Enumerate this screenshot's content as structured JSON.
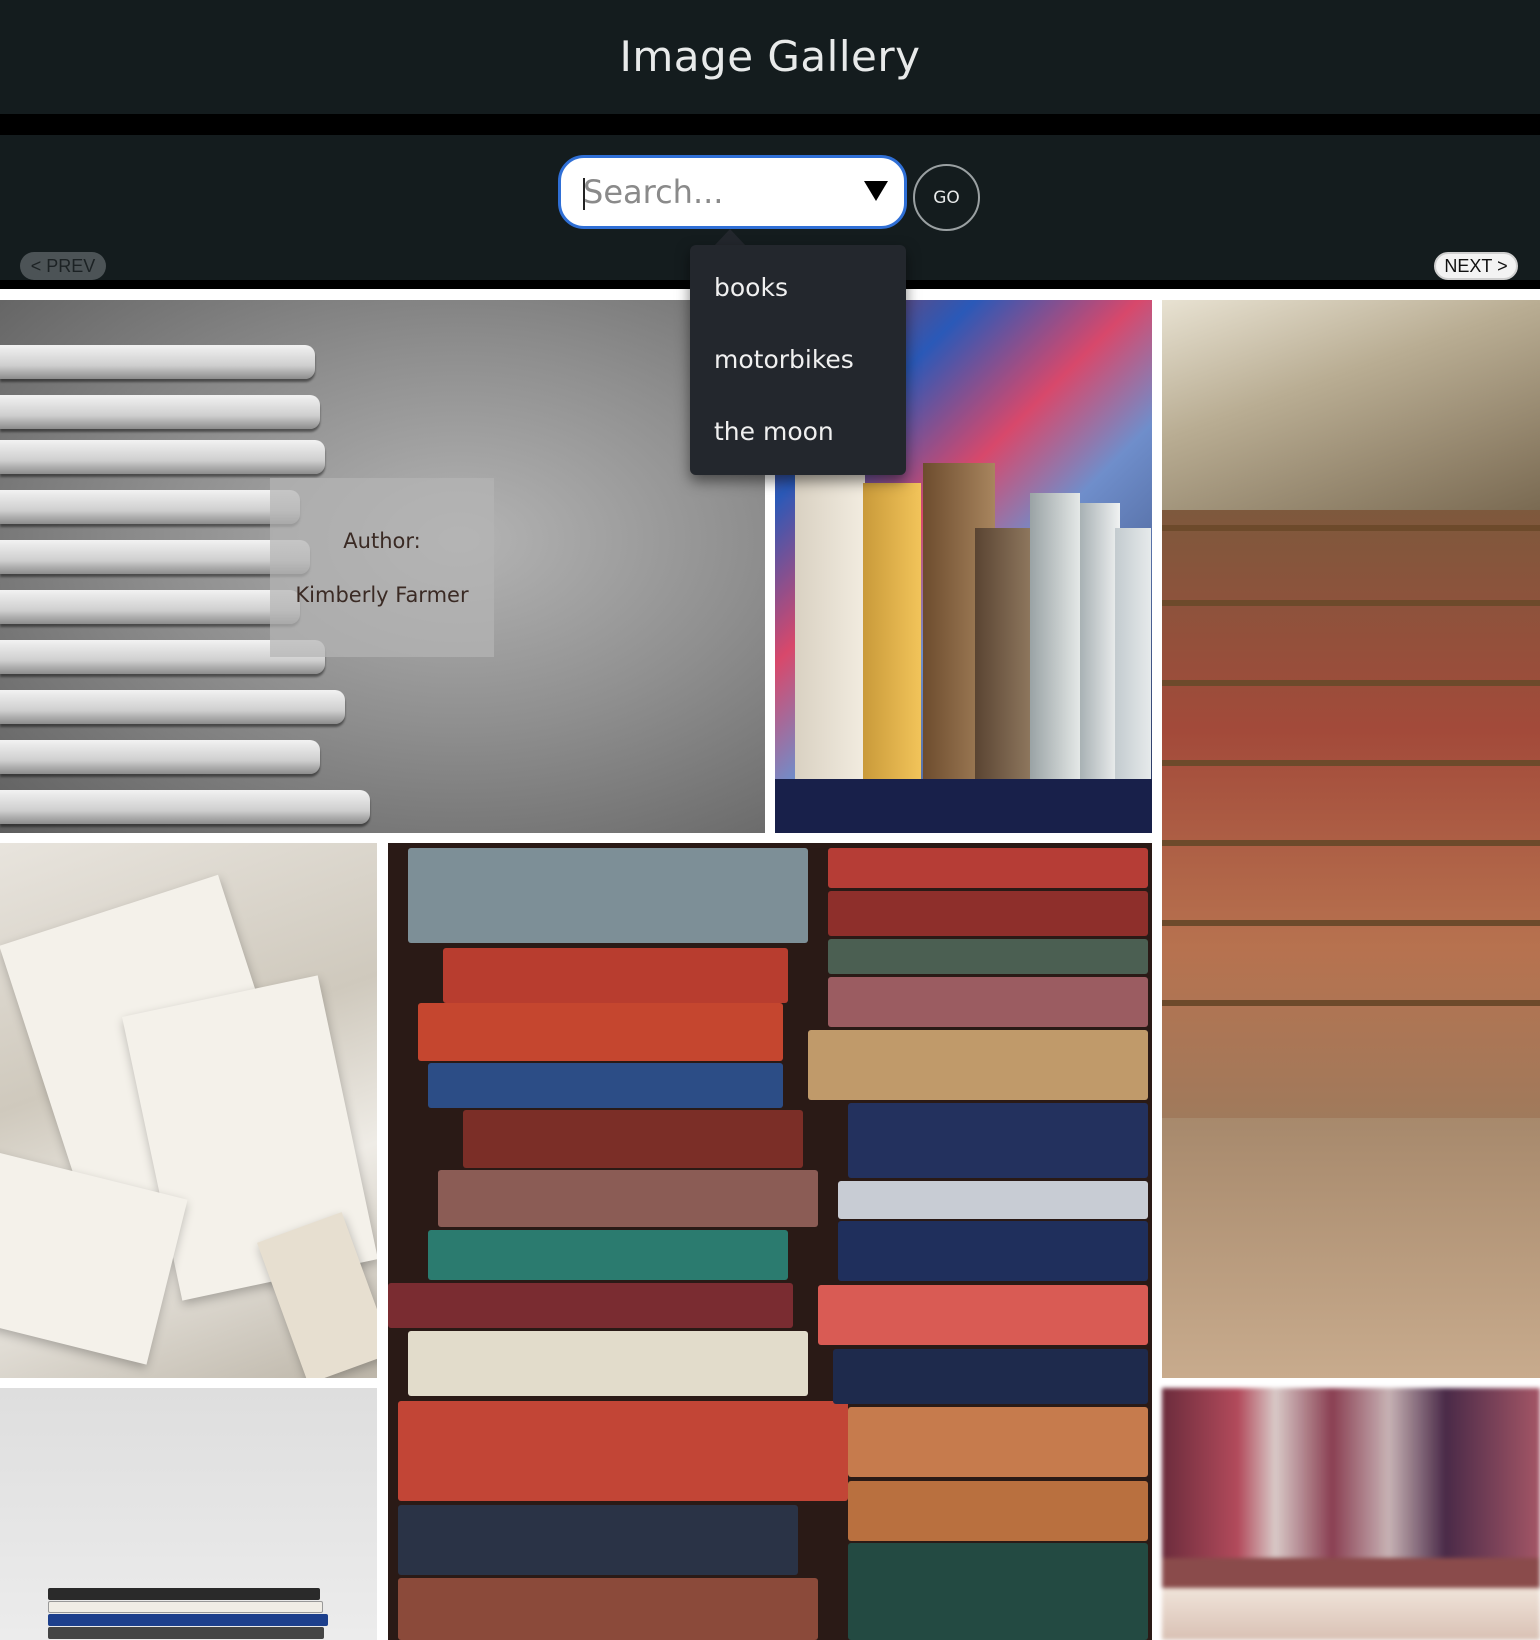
{
  "header": {
    "title": "Image Gallery"
  },
  "search": {
    "placeholder": "Search...",
    "go_label": "GO"
  },
  "pagination": {
    "prev_label": "< PREV",
    "next_label": "NEXT >"
  },
  "search_suggestions": [
    "books",
    "motorbikes",
    "the moon"
  ],
  "gallery": {
    "featured_overlay": {
      "label": "Author:",
      "name": "Kimberly Farmer"
    }
  },
  "colors": {
    "header_bg": "#141c1e",
    "search_border": "#2f6fd6",
    "menu_bg": "#23272d"
  }
}
